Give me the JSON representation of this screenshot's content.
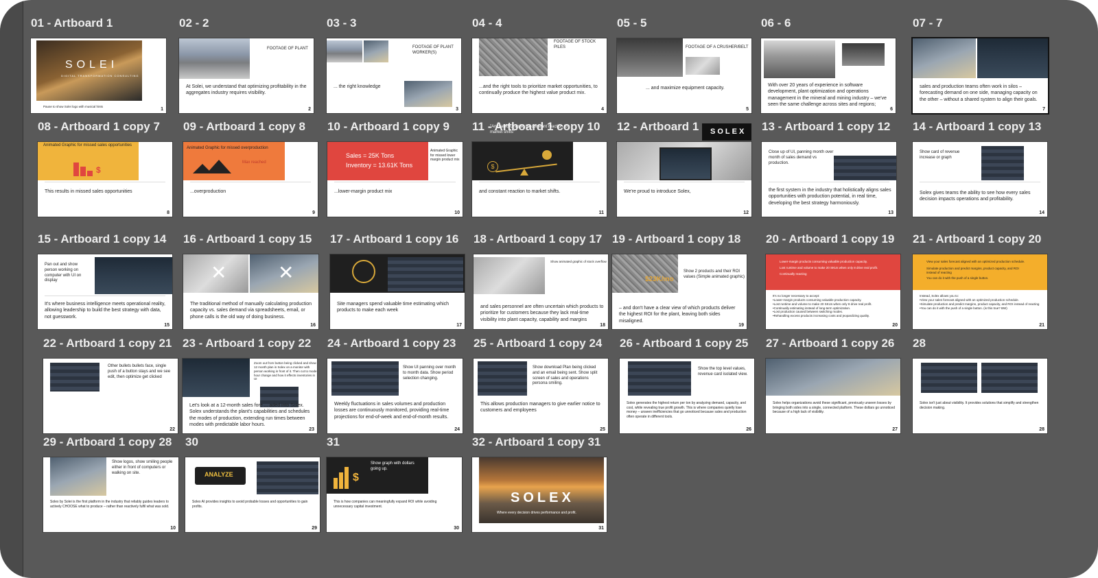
{
  "boards": [
    {
      "id": "b01",
      "title": "01 - Artboard 1",
      "caption": "Pause to show Solei logo with musical hints",
      "page": "1",
      "logo": "SOLEI",
      "sub": "DIGITAL TRANSFORMATION CONSULTING"
    },
    {
      "id": "b02",
      "title": "02 - 2",
      "label": "FOOTAGE OF PLANT",
      "caption": "At Solei, we understand that optimizing profitability in the aggregates industry requires visibility.",
      "page": "2"
    },
    {
      "id": "b03",
      "title": "03 - 3",
      "label": "FOOTAGE OF PLANT WORKER(S)",
      "caption": "... the right knowledge",
      "page": "3"
    },
    {
      "id": "b04",
      "title": "04 - 4",
      "label": "FOOTAGE OF STOCK PILES",
      "caption": "...and the right tools to prioritize market opportunities, to continually produce the highest value product mix.",
      "page": "4"
    },
    {
      "id": "b05",
      "title": "05 - 5",
      "label": "FOOTAGE OF A CRUSHER/BELT",
      "caption": "... and maximize equipment capacity.",
      "page": "5"
    },
    {
      "id": "b06",
      "title": "06 - 6",
      "caption": "With over 20 years of experience in software development, plant optimization and operations management in the mineral and mining industry – we've seen the same challenge across sites and regions;",
      "page": "6"
    },
    {
      "id": "b07",
      "title": "07 - 7",
      "caption": "sales and production teams often work in silos – forecasting demand on one side, managing capacity on the other – without a shared system to align their goals.",
      "page": "7"
    },
    {
      "id": "b08",
      "title": "08 - Artboard 1 copy 7",
      "label": "Animated Graphic for missed sales opportunities",
      "caption": "This results in missed sales opportunities",
      "page": "8"
    },
    {
      "id": "b09",
      "title": "09 - Artboard 1 copy 8",
      "label": "Animated Graphic for missed overproduction",
      "badge": "Max reached",
      "caption": "...overproduction",
      "page": "9"
    },
    {
      "id": "b10",
      "title": "10 - Artboard 1 copy 9",
      "sales": "Sales = 25K Tons",
      "inventory": "Inventory = 13.61K Tons",
      "label": "Animated Graphic for missed lower margin product mix",
      "caption": "...lower-margin product mix",
      "page": "10"
    },
    {
      "id": "b11",
      "title": "11 - Artboard 1 copy 10",
      "overlay": "\"Animated Graphic for constant reaction to market shifts\"",
      "caption": "and constant reaction to market shifts.",
      "page": "11"
    },
    {
      "id": "b12",
      "title": "12 - Artboard 1",
      "logo": "SOLEX",
      "caption": "We're proud to introduce Solex,",
      "page": "12"
    },
    {
      "id": "b13",
      "title": "13 - Artboard 1 copy 12",
      "label": "Close up of UI, panning month over month of sales demand vs production.",
      "caption": "the first system in the industry that holistically aligns sales opportunities with production potential, in real time, developing the best strategy harmoniously.",
      "page": "13"
    },
    {
      "id": "b14",
      "title": "14 - Artboard 1 copy 13",
      "label": "Show card of revenue increase or graph",
      "caption": "Solex gives teams the ability to see how every sales decision impacts operations and profitability.",
      "page": "14"
    },
    {
      "id": "b15",
      "title": "15 - Artboard 1 copy 14",
      "label": "Pan out and show person working on computer with UI on display",
      "caption": "It's where business intelligence meets operational reality, allowing leadership to build the best strategy with data, not guesswork.",
      "page": "15"
    },
    {
      "id": "b16",
      "title": "16 - Artboard 1 copy 15",
      "caption": "The traditional method of manually calculating production capacity vs. sales demand via spreadsheets, email, or phone calls is the old way of doing business.",
      "page": "16"
    },
    {
      "id": "b17",
      "title": "17 - Artboard 1 copy 16",
      "caption": "Site managers spend valuable time estimating which products to make each week",
      "page": "17"
    },
    {
      "id": "b18",
      "title": "18 - Artboard 1 copy 17",
      "label": "Show animated graphic of stock overflow",
      "caption": "and sales personnel are often uncertain which products to prioritize for customers because they lack real-time visibility into plant capacity, capability and margins",
      "page": "18"
    },
    {
      "id": "b19",
      "title": "19 - Artboard 1 copy 18",
      "price": "$23K/mo",
      "label": "Show 2 products and their ROI values (Simple animated graphic)",
      "caption": "– and don't have a clear view of which products deliver the highest ROI for the plant, leaving both sides misaligned.",
      "page": "19"
    },
    {
      "id": "b20",
      "title": "20 - Artboard 1 copy 19",
      "bullets": [
        "Lower-margin products consuming valuable production capacity.",
        "Lost runtime and volume to make 20 SKUs when only 8 drive real profit.",
        "Continually reacting"
      ],
      "caption": "It's no longer necessary to accept:\n•Lower-margin products consuming valuable production capacity.\n•Lost runtime and volume to make 20 SKUs when only 8 drive real profit.\n•Continually estimating instead of long-term optimization.\n•Lost production caused between switching modes.\n•Rehandling excess products increasing costs and jeopardizing quality.",
      "page": "20"
    },
    {
      "id": "b21",
      "title": "21 - Artboard 1 copy 20",
      "bullets": [
        "View your sales forecast aligned with an optimized production schedule.",
        "Simulate production and predict margins, product capacity, and ROI instead of reacting",
        "You can do it with the push of a single button."
      ],
      "caption": "Instead, Solex allows you to:\n•View your sales forecast aligned with an optimized production schedule.\n•Simulate production and predict margins, product capacity, and ROI instead of reacting\n•You can do it with the push of a single button. (is this true? BW)",
      "page": "21"
    },
    {
      "id": "b22",
      "title": "22 - Artboard 1 copy 21",
      "label": "Other bullets bullets face, single push of a button stays and we see edit, then optimize get clicked",
      "page": "22"
    },
    {
      "id": "b23",
      "title": "23 - Artboard 1 copy 22",
      "label": "Zoom out from button being clicked and show 12 month plan in Solex on a monitor with person working in front of it. Then cut to mode hour change and how it effects inventories in UI",
      "caption": "Let's look at a 12-month sales fore ... aded into Solex. Solex understands the plant's capabilities and schedules the modes of production, extending run times between modes with predictable labor hours.",
      "page": "23"
    },
    {
      "id": "b24",
      "title": "24 - Artboard 1 copy 23",
      "label": "Show UI panning over month to month data. Show period selection changing.",
      "caption": "Weekly fluctuations in sales volumes and production losses are continuously monitored, providing real-time projections for end-of-week and end-of-month results.",
      "page": "24"
    },
    {
      "id": "b25",
      "title": "25 - Artboard 1 copy 24",
      "label": "Show download Plan being clicked and an email being sent. Show split screen of sales and operations persona smiling.",
      "caption": "This allows production managers to give earlier notice to customers and employees",
      "page": "25"
    },
    {
      "id": "b26",
      "title": "26 - Artboard 1 copy 25",
      "label": "Show the top level values, revenue card isolated view.",
      "caption": "Solex generates the highest return per ton by analyzing demand, capacity, and cost, while revealing true profit growth. This is where companies quietly lose money – unseen inefficiencies that go unnoticed because sales and production often operate in different tools.",
      "page": "26"
    },
    {
      "id": "b27",
      "title": "27 - Artboard 1 copy 26",
      "caption": "Solex helps organizations avoid these significant, previously unseen losses by bringing both sides into a single, connected platform. These dollars go unnoticed because of a high lack of visibility.",
      "page": "27"
    },
    {
      "id": "b28",
      "title": "28",
      "caption": "Solex isn't just about visibility. It provides solutions that simplify and strengthen decision making.",
      "page": "28"
    },
    {
      "id": "b29",
      "title": "29 - Artboard 1 copy 28",
      "label": "Show logos, show smiling people either in front of computers or walking on site.",
      "caption": "Solex by Solei is the first platform in the industry that reliably guides leaders to actively CHOOSE what to produce – rather than reactively fulfil what was sold.",
      "page": "10"
    },
    {
      "id": "b30",
      "title": "30",
      "button": "ANALYZE",
      "caption": "Solex AI provides insights to avoid probable losses and opportunities to gain profits.",
      "page": "29"
    },
    {
      "id": "b31",
      "title": "31",
      "label": "Show graph with dollars going up.",
      "caption": "This is how companies can meaningfully expand ROI while avoiding unnecessary capital investment.",
      "page": "30"
    },
    {
      "id": "b32",
      "title": "32 - Artboard 1 copy 31",
      "logo": "SOLEX",
      "tagline": "Where every decision drives performance and profit.",
      "page": "31"
    }
  ]
}
